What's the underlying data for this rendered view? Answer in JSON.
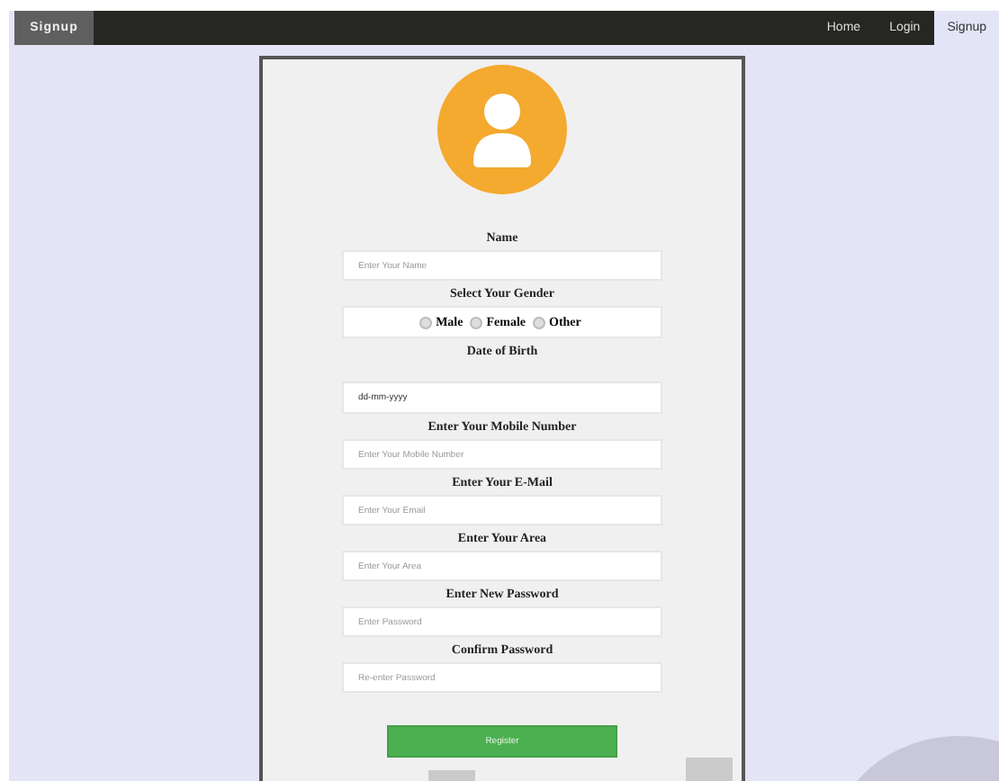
{
  "navbar": {
    "brand": "Signup",
    "links": [
      {
        "label": "Home",
        "selected": false
      },
      {
        "label": "Login",
        "selected": false
      },
      {
        "label": "Signup",
        "selected": true
      }
    ]
  },
  "form": {
    "fields": [
      {
        "kind": "text",
        "label": "Name",
        "placeholder": "Enter Your Name"
      },
      {
        "kind": "radio",
        "label": "Select Your Gender",
        "options": [
          {
            "label": "Male",
            "selected": false
          },
          {
            "label": "Female",
            "selected": false
          },
          {
            "label": "Other",
            "selected": false
          }
        ]
      },
      {
        "kind": "date",
        "label": "Date of Birth",
        "placeholder": "dd-mm-yyyy"
      },
      {
        "kind": "text",
        "label": "Enter Your Mobile Number",
        "placeholder": "Enter Your Mobile Number"
      },
      {
        "kind": "text",
        "label": "Enter Your E-Mail",
        "placeholder": "Enter Your Email"
      },
      {
        "kind": "text",
        "label": "Enter Your Area",
        "placeholder": "Enter Your Area"
      },
      {
        "kind": "text",
        "label": "Enter New Password",
        "placeholder": "Enter Password"
      },
      {
        "kind": "text",
        "label": "Confirm Password",
        "placeholder": "Re-enter Password"
      }
    ],
    "submit": "Register"
  }
}
